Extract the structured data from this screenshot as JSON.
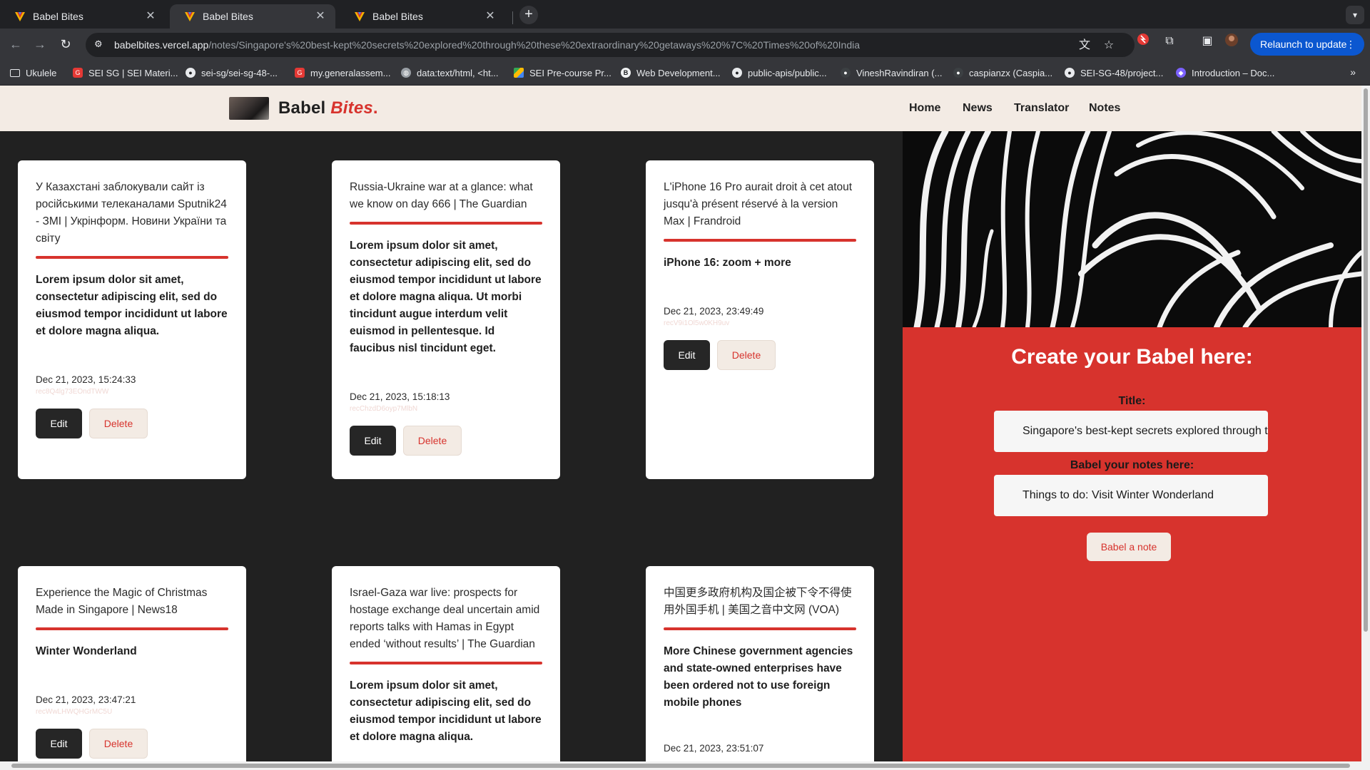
{
  "browser": {
    "tabs": [
      {
        "title": "Babel Bites",
        "active": false
      },
      {
        "title": "Babel Bites",
        "active": true
      },
      {
        "title": "Babel Bites",
        "active": false
      }
    ],
    "url_host": "babelbites.vercel.app",
    "url_path": "/notes/Singapore's%20best-kept%20secrets%20explored%20through%20these%20extraordinary%20getaways%20%7C%20Times%20of%20India",
    "relaunch_label": "Relaunch to update",
    "bookmarks": [
      {
        "label": "Ukulele",
        "icon": "folder-icon"
      },
      {
        "label": "SEI SG | SEI Materi...",
        "icon": "ga-icon"
      },
      {
        "label": "sei-sg/sei-sg-48-...",
        "icon": "github-icon"
      },
      {
        "label": "my.generalassem...",
        "icon": "ga-icon"
      },
      {
        "label": "data:text/html, <ht...",
        "icon": "globe-icon"
      },
      {
        "label": "SEI Pre-course Pr...",
        "icon": "drive-icon"
      },
      {
        "label": "Web Development...",
        "icon": "b-icon"
      },
      {
        "label": "public-apis/public...",
        "icon": "github-icon"
      },
      {
        "label": "VineshRavindiran (...",
        "icon": "github-icon"
      },
      {
        "label": "caspianzx (Caspia...",
        "icon": "github-icon"
      },
      {
        "label": "SEI-SG-48/project...",
        "icon": "github-icon"
      },
      {
        "label": "Introduction – Doc...",
        "icon": "doc-icon"
      }
    ]
  },
  "site": {
    "brand_main": "Babel",
    "brand_accent": "Bites",
    "brand_dot": ".",
    "nav": [
      "Home",
      "News",
      "Translator",
      "Notes"
    ]
  },
  "cards": [
    {
      "title": "У Казахстані заблокували сайт із російськими телеканалами Sputnik24 - ЗМІ | Укрінформ. Новини України та світу",
      "body": "Lorem ipsum dolor sit amet, consectetur adipiscing elit, sed do eiusmod tempor incididunt ut labore et dolore magna aliqua.",
      "date": "Dec 21, 2023, 15:24:33",
      "id": "rec8Q4lg73EOndTWW",
      "edit": "Edit",
      "delete": "Delete"
    },
    {
      "title": "Russia-Ukraine war at a glance: what we know on day 666 | The Guardian",
      "body": "Lorem ipsum dolor sit amet, consectetur adipiscing elit, sed do eiusmod tempor incididunt ut labore et dolore magna aliqua. Ut morbi tincidunt augue interdum velit euismod in pellentesque. Id faucibus nisl tincidunt eget.",
      "date": "Dec 21, 2023, 15:18:13",
      "id": "recChzdD6oyp7MlbN",
      "edit": "Edit",
      "delete": "Delete"
    },
    {
      "title": "L'iPhone 16 Pro aurait droit à cet atout jusqu'à présent réservé à la version Max | Frandroid",
      "body": "iPhone 16: zoom + more",
      "date": "Dec 21, 2023, 23:49:49",
      "id": "recV9i1Ol5w0KH9uv",
      "edit": "Edit",
      "delete": "Delete"
    },
    {
      "title": "Experience the Magic of Christmas Made in Singapore | News18",
      "body": "Winter Wonderland",
      "date": "Dec 21, 2023, 23:47:21",
      "id": "recWwLHWQHGrMC5U",
      "edit": "Edit",
      "delete": "Delete"
    },
    {
      "title": "Israel-Gaza war live: prospects for hostage exchange deal uncertain amid reports talks with Hamas in Egypt ended ‘without results’ | The Guardian",
      "body": "Lorem ipsum dolor sit amet, consectetur adipiscing elit, sed do eiusmod tempor incididunt ut labore et dolore magna aliqua.",
      "date": "",
      "id": "",
      "edit": "Edit",
      "delete": "Delete"
    },
    {
      "title": "中国更多政府机构及国企被下令不得使用外国手机 | 美国之音中文网 (VOA)",
      "body": "More Chinese government agencies and state-owned enterprises have been ordered not to use foreign mobile phones",
      "date": "Dec 21, 2023, 23:51:07",
      "id": "",
      "edit": "Edit",
      "delete": "Delete"
    }
  ],
  "form": {
    "heading": "Create your Babel here:",
    "title_label": "Title:",
    "title_value": "Singapore's best-kept secrets explored through these extraordinary getaways | Times of India",
    "notes_label": "Babel your notes here:",
    "notes_value": "Things to do: Visit Winter Wonderland",
    "submit_label": "Babel a note"
  },
  "colors": {
    "accent": "#d7332d",
    "nav_bg": "#f3ebe4",
    "page_bg": "#212121",
    "button_dark": "#262626"
  }
}
